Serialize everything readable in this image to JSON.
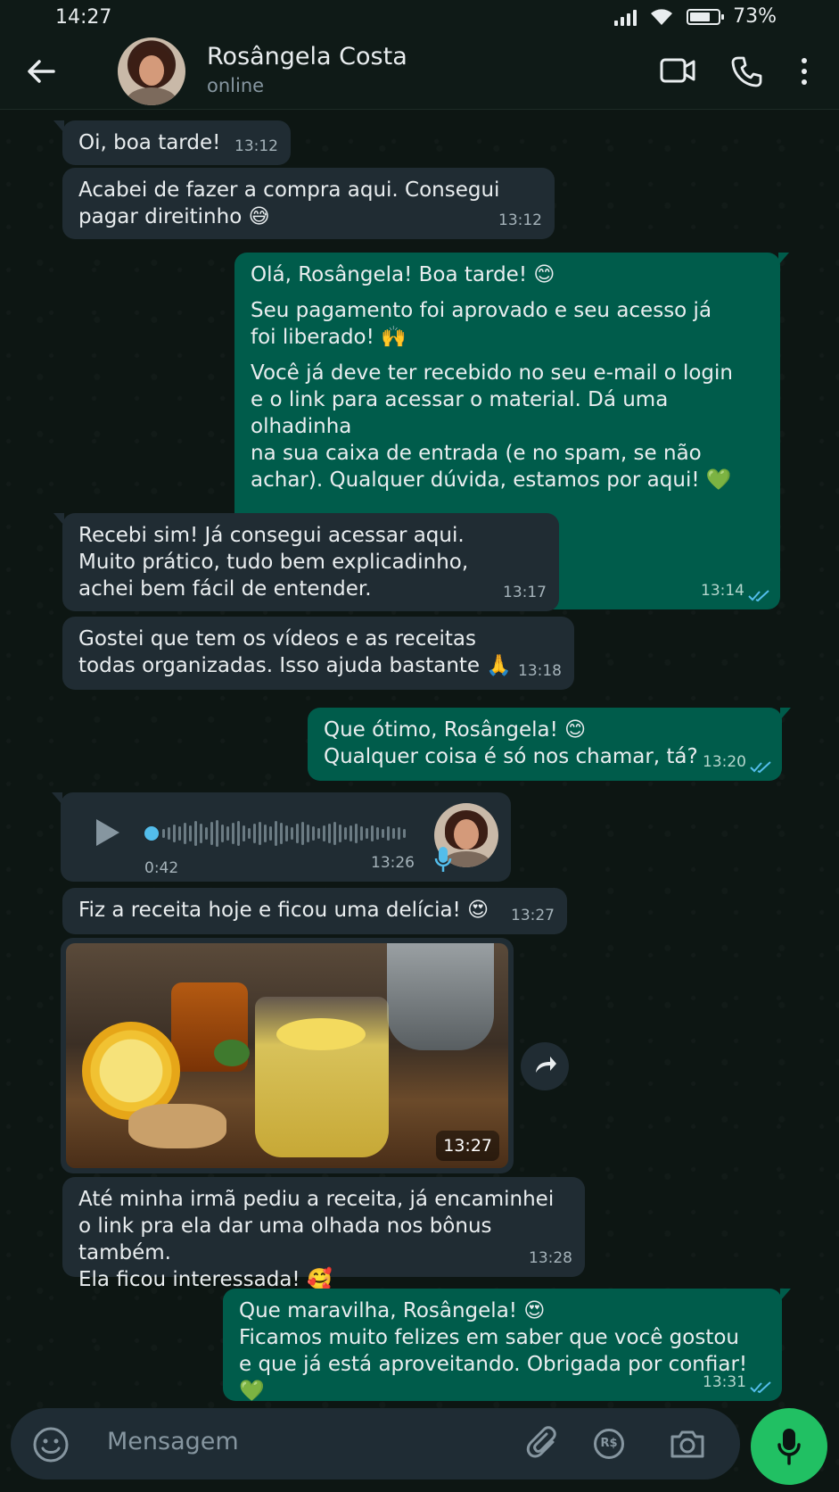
{
  "status_bar": {
    "time": "14:27",
    "battery": "73%",
    "battery_level": 0.73
  },
  "header": {
    "contact_name": "Rosângela Costa",
    "contact_status": "online"
  },
  "messages": [
    {
      "dir": "in",
      "lines": [
        "Oi, boa tarde!"
      ],
      "time": "13:12"
    },
    {
      "dir": "in",
      "lines": [
        "Acabei de fazer a compra aqui. Consegui",
        "pagar direitinho 😅"
      ],
      "time": "13:12"
    },
    {
      "dir": "out",
      "paragraphs": [
        [
          "Olá, Rosângela! Boa tarde! 😊"
        ],
        [
          "Seu pagamento foi aprovado e seu acesso já",
          "foi liberado! 🙌"
        ],
        [
          "Você já deve ter recebido no seu e-mail o login",
          "e o link para acessar o material. Dá uma olhadinha",
          "na sua caixa de entrada (e no spam, se não",
          "achar). Qualquer dúvida, estamos por aqui! 💚"
        ]
      ],
      "time": "13:14"
    },
    {
      "dir": "in",
      "lines": [
        "Recebi sim! Já consegui acessar aqui.",
        "Muito prático, tudo bem explicadinho,",
        "achei bem fácil de entender."
      ],
      "time": "13:17"
    },
    {
      "dir": "in",
      "lines": [
        "Gostei que tem os vídeos e as receitas",
        "todas organizadas. Isso ajuda bastante 🙏"
      ],
      "time": "13:18"
    },
    {
      "dir": "out",
      "lines": [
        "Que ótimo, Rosângela! 😊",
        "Qualquer coisa é só nos chamar, tá?"
      ],
      "time": "13:20"
    },
    {
      "dir": "in",
      "type": "voice",
      "duration": "0:42",
      "time": "13:26"
    },
    {
      "dir": "in",
      "lines": [
        "Fiz a receita hoje e ficou uma delícia! 😍"
      ],
      "time": "13:27"
    },
    {
      "dir": "in",
      "type": "image",
      "time": "13:27"
    },
    {
      "dir": "in",
      "lines": [
        "Até minha irmã pediu a receita, já encaminhei",
        "o link pra ela dar uma olhada nos bônus também.",
        "Ela ficou interessada! 🥰"
      ],
      "time": "13:28"
    },
    {
      "dir": "out",
      "lines": [
        "Que maravilha, Rosângela! 😍",
        "Ficamos muito felizes em saber que você gostou",
        "e que já está aproveitando. Obrigada por confiar! 💚"
      ],
      "time": "13:31"
    }
  ],
  "composer": {
    "placeholder": "Mensagem",
    "currency_icon_text": "R$"
  },
  "colors": {
    "incoming_bubble": "#202c33",
    "outgoing_bubble": "#005c4b",
    "accent": "#21c063",
    "read_ticks": "#53bdeb"
  }
}
